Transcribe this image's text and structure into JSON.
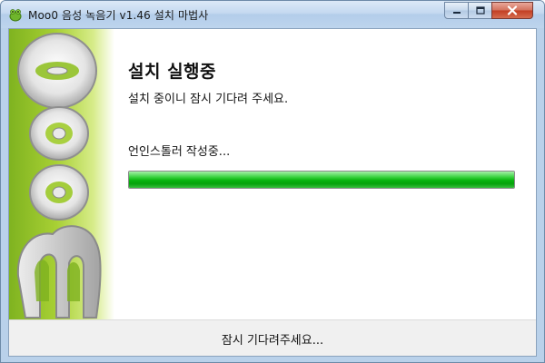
{
  "window": {
    "title": "Moo0 음성 녹음기 v1.46 설치 마법사",
    "app_icon": "frog-icon",
    "controls": {
      "minimize": "minimize-icon",
      "maximize": "maximize-icon",
      "close": "close-icon"
    }
  },
  "banner": {
    "logo_text": "Moo0"
  },
  "main": {
    "heading": "설치 실행중",
    "subtext": "설치 중이니 잠시 기다려 주세요.",
    "status": "언인스톨러 작성중...",
    "progress_fraction": 1.0
  },
  "footer": {
    "text": "잠시 기다려주세요..."
  },
  "colors": {
    "progress_green": "#07b30e",
    "banner_green": "#8cc22a",
    "titlebar": "#c4d9f0",
    "close_red": "#c23d22"
  }
}
